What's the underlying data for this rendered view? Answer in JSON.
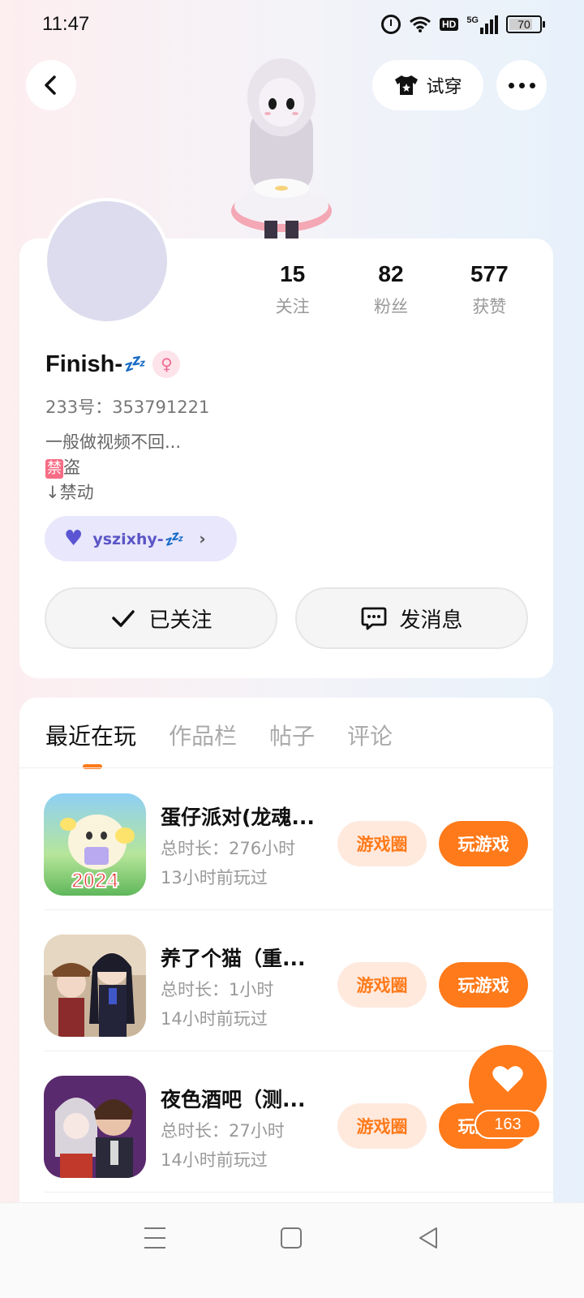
{
  "status_bar": {
    "time": "11:47",
    "network": "5G",
    "hd_badge": "HD",
    "battery": "70"
  },
  "header": {
    "try_on_label": "试穿"
  },
  "profile": {
    "stats": [
      {
        "value": "15",
        "label": "关注"
      },
      {
        "value": "82",
        "label": "粉丝"
      },
      {
        "value": "577",
        "label": "获赞"
      }
    ],
    "username": "Finish-",
    "username_emoji": "💤",
    "uid": "233号：353791221",
    "bio_line1": "一般做视频不回...",
    "bio_line2_badge": "禁",
    "bio_line2_text": "盗",
    "bio_line3": "↓禁动",
    "couple_name": "yszixhy-",
    "couple_emoji": "💤",
    "follow_label": "已关注",
    "message_label": "发消息"
  },
  "tabs": [
    {
      "label": "最近在玩",
      "active": true
    },
    {
      "label": "作品栏",
      "active": false
    },
    {
      "label": "帖子",
      "active": false
    },
    {
      "label": "评论",
      "active": false
    }
  ],
  "games": [
    {
      "name": "蛋仔派对(龙魂...",
      "total_time": "总时长：276小时",
      "last_played": "13小时前玩过",
      "circle_label": "游戏圈",
      "play_label": "玩游戏",
      "icon_text": "2024"
    },
    {
      "name": "养了个猫（重...",
      "total_time": "总时长：1小时",
      "last_played": "14小时前玩过",
      "circle_label": "游戏圈",
      "play_label": "玩游戏"
    },
    {
      "name": "夜色酒吧（测...",
      "total_time": "总时长：27小时",
      "last_played": "14小时前玩过",
      "circle_label": "游戏圈",
      "play_label": "玩游戏"
    }
  ],
  "like_count": "163",
  "colors": {
    "accent": "#ff7a1a",
    "accent_light": "#ffe9dd",
    "couple_bg": "#e8e7fb",
    "couple_text": "#5b55c6"
  }
}
